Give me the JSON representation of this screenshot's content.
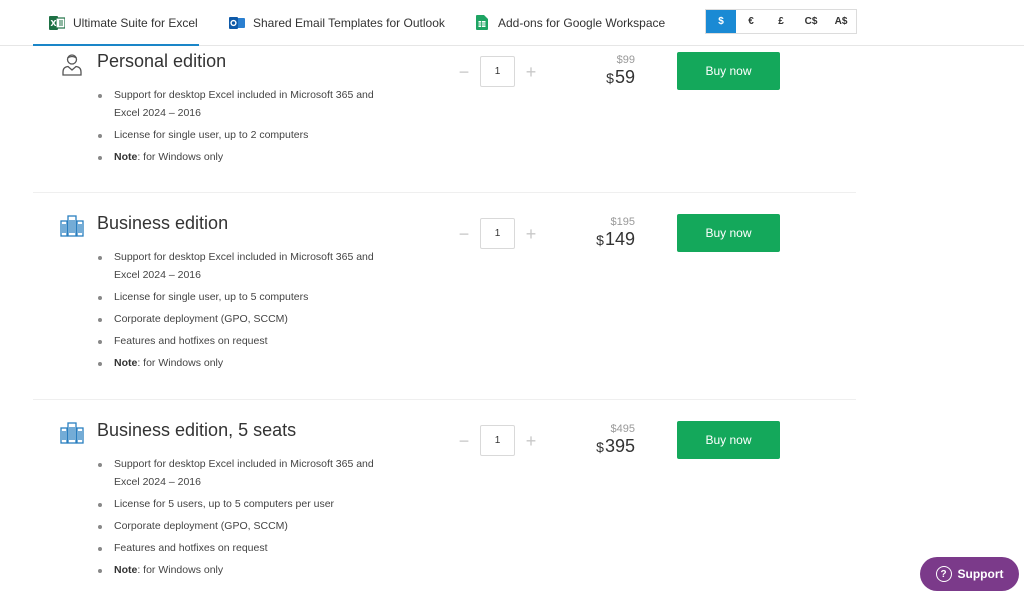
{
  "tabs": [
    {
      "label": "Ultimate Suite for Excel",
      "icon": "excel-icon",
      "active": true
    },
    {
      "label": "Shared Email Templates for Outlook",
      "icon": "outlook-icon",
      "active": false
    },
    {
      "label": "Add-ons for Google Workspace",
      "icon": "google-sheets-icon",
      "active": false
    }
  ],
  "currencies": [
    {
      "label": "$",
      "active": true
    },
    {
      "label": "€",
      "active": false
    },
    {
      "label": "£",
      "active": false
    },
    {
      "label": "C$",
      "active": false
    },
    {
      "label": "A$",
      "active": false
    }
  ],
  "products": [
    {
      "title": "Personal edition",
      "icon": "person-icon",
      "features": [
        "Support for desktop Excel included in Microsoft 365 and Excel 2024 – 2016",
        "License for single user, up to 2 computers"
      ],
      "note_label": "Note",
      "note_text": ": for Windows only",
      "quantity": "1",
      "old_price": "$99",
      "currency_symbol": "$",
      "new_price": "59",
      "buy_label": "Buy now"
    },
    {
      "title": "Business edition",
      "icon": "building-icon",
      "features": [
        "Support for desktop Excel included in Microsoft 365 and Excel 2024 – 2016",
        "License for single user, up to 5 computers",
        "Corporate deployment (GPO, SCCM)",
        "Features and hotfixes on request"
      ],
      "note_label": "Note",
      "note_text": ": for Windows only",
      "quantity": "1",
      "old_price": "$195",
      "currency_symbol": "$",
      "new_price": "149",
      "buy_label": "Buy now"
    },
    {
      "title": "Business edition, 5 seats",
      "icon": "building-icon",
      "features": [
        "Support for desktop Excel included in Microsoft 365 and Excel 2024 – 2016",
        "License for 5 users, up to 5 computers per user",
        "Corporate deployment (GPO, SCCM)",
        "Features and hotfixes on request"
      ],
      "note_label": "Note",
      "note_text": ": for Windows only",
      "quantity": "1",
      "old_price": "$495",
      "currency_symbol": "$",
      "new_price": "395",
      "buy_label": "Buy now"
    }
  ],
  "stepper": {
    "minus": "−",
    "plus": "+"
  },
  "support": {
    "label": "Support",
    "icon": "question-icon",
    "icon_glyph": "?"
  },
  "colors": {
    "accent": "#1a8ad4",
    "buy": "#14a85b",
    "support": "#7b3a8a"
  }
}
